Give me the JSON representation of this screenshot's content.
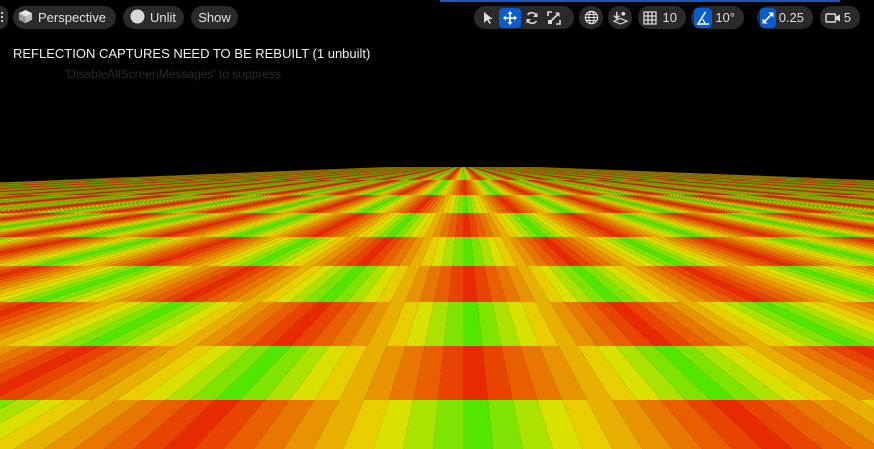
{
  "toolbar": {
    "view_mode": "Perspective",
    "lighting_mode": "Unlit",
    "show_label": "Show",
    "grid_snap_value": "10",
    "rotation_snap_value": "10°",
    "scale_snap_value": "0.25",
    "camera_speed_value": "5"
  },
  "viewport": {
    "message": "REFLECTION CAPTURES NEED TO BE REBUILT (1 unbuilt)",
    "suppress_hint": "'DisableAllScreenMessages' to suppress"
  },
  "colors": {
    "accent": "#0b5bd0",
    "toolbar_bg": "#2a2a2a",
    "floor_green": "#52e600",
    "floor_yellow": "#e8e000",
    "floor_orange": "#e88000",
    "floor_red": "#e82a00"
  },
  "icons": [
    "menu-icon",
    "cube-icon",
    "circle-icon",
    "select-arrow-icon",
    "move-icon",
    "rotate-icon",
    "scale-icon",
    "globe-icon",
    "surface-snap-icon",
    "grid-icon",
    "angle-icon",
    "scale-snap-icon",
    "camera-icon"
  ]
}
